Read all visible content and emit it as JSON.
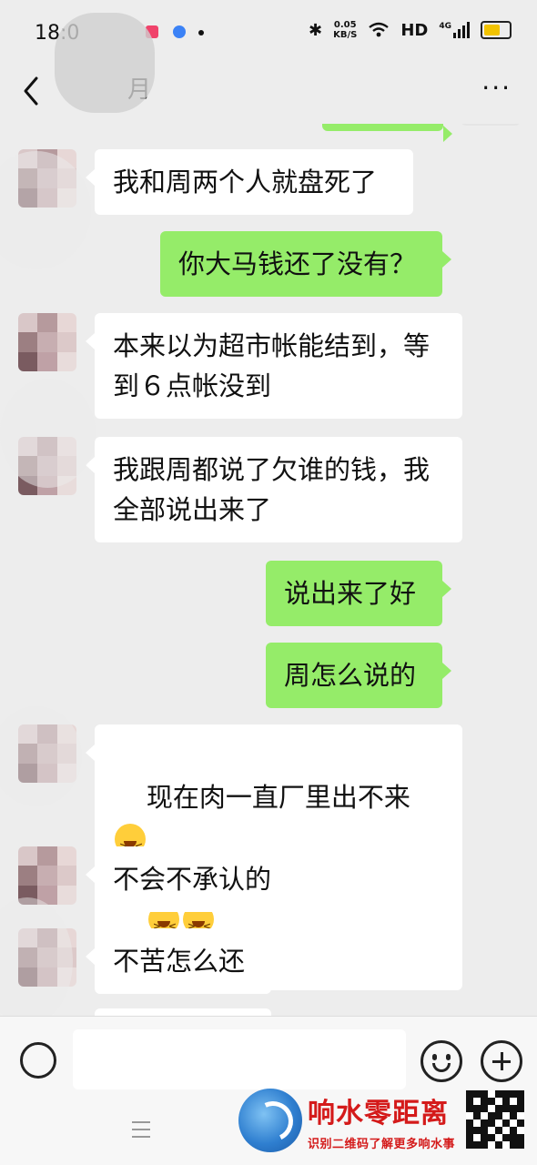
{
  "status_bar": {
    "time": "18:0",
    "net_speed_value": "0.05",
    "net_speed_unit": "KB/S",
    "hd": "HD",
    "network": "4G",
    "battery_level": 0.75
  },
  "header": {
    "title": "月",
    "more": "···"
  },
  "messages": [
    {
      "side": "in",
      "text": "我和周两个人就盘死了"
    },
    {
      "side": "out",
      "text": "你大马钱还了没有？"
    },
    {
      "side": "in",
      "text": "本来以为超市帐能结到，等\n到６点帐没到"
    },
    {
      "side": "in",
      "text": "我跟周都说了欠谁的钱，我\n全部说出来了"
    },
    {
      "side": "out",
      "text": "说出来了好"
    },
    {
      "side": "out",
      "text": "周怎么说的"
    },
    {
      "side": "in",
      "text": "现在肉一直厂里出不来"
    },
    {
      "side": "in",
      "text": "不会不承认的"
    },
    {
      "side": "in",
      "text": "不苦怎么还"
    }
  ],
  "watermark": {
    "title": "响水零距离",
    "subtitle": "识别二维码了解更多响水事"
  },
  "colors": {
    "chat_bg": "#ededed",
    "bubble_in": "#ffffff",
    "bubble_out": "#95ec69",
    "watermark": "#d41a1a"
  }
}
